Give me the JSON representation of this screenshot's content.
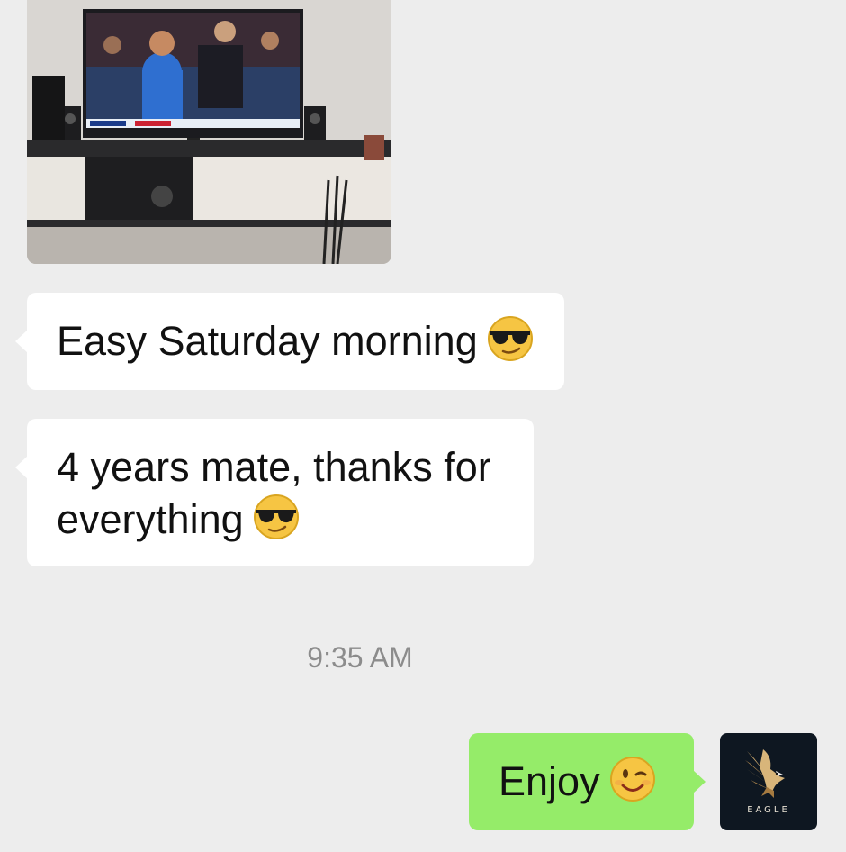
{
  "messages": [
    {
      "type": "image",
      "direction": "incoming",
      "content": "photo of a TV showing a basketball game"
    },
    {
      "type": "text",
      "direction": "incoming",
      "text": "Easy Saturday morning",
      "emoji": "sunglasses-emoji"
    },
    {
      "type": "text",
      "direction": "incoming",
      "text": "4 years mate, thanks for everything",
      "emoji": "sunglasses-emoji"
    },
    {
      "type": "timestamp",
      "text": "9:35 AM"
    },
    {
      "type": "text",
      "direction": "outgoing",
      "text": "Enjoy",
      "emoji": "winking-face-emoji"
    }
  ],
  "avatar": {
    "label": "EAGLE",
    "icon": "eagle-logo"
  },
  "colors": {
    "background": "#ededed",
    "incoming_bubble": "#ffffff",
    "outgoing_bubble": "#95ec69",
    "timestamp_text": "#8c8c8c"
  }
}
